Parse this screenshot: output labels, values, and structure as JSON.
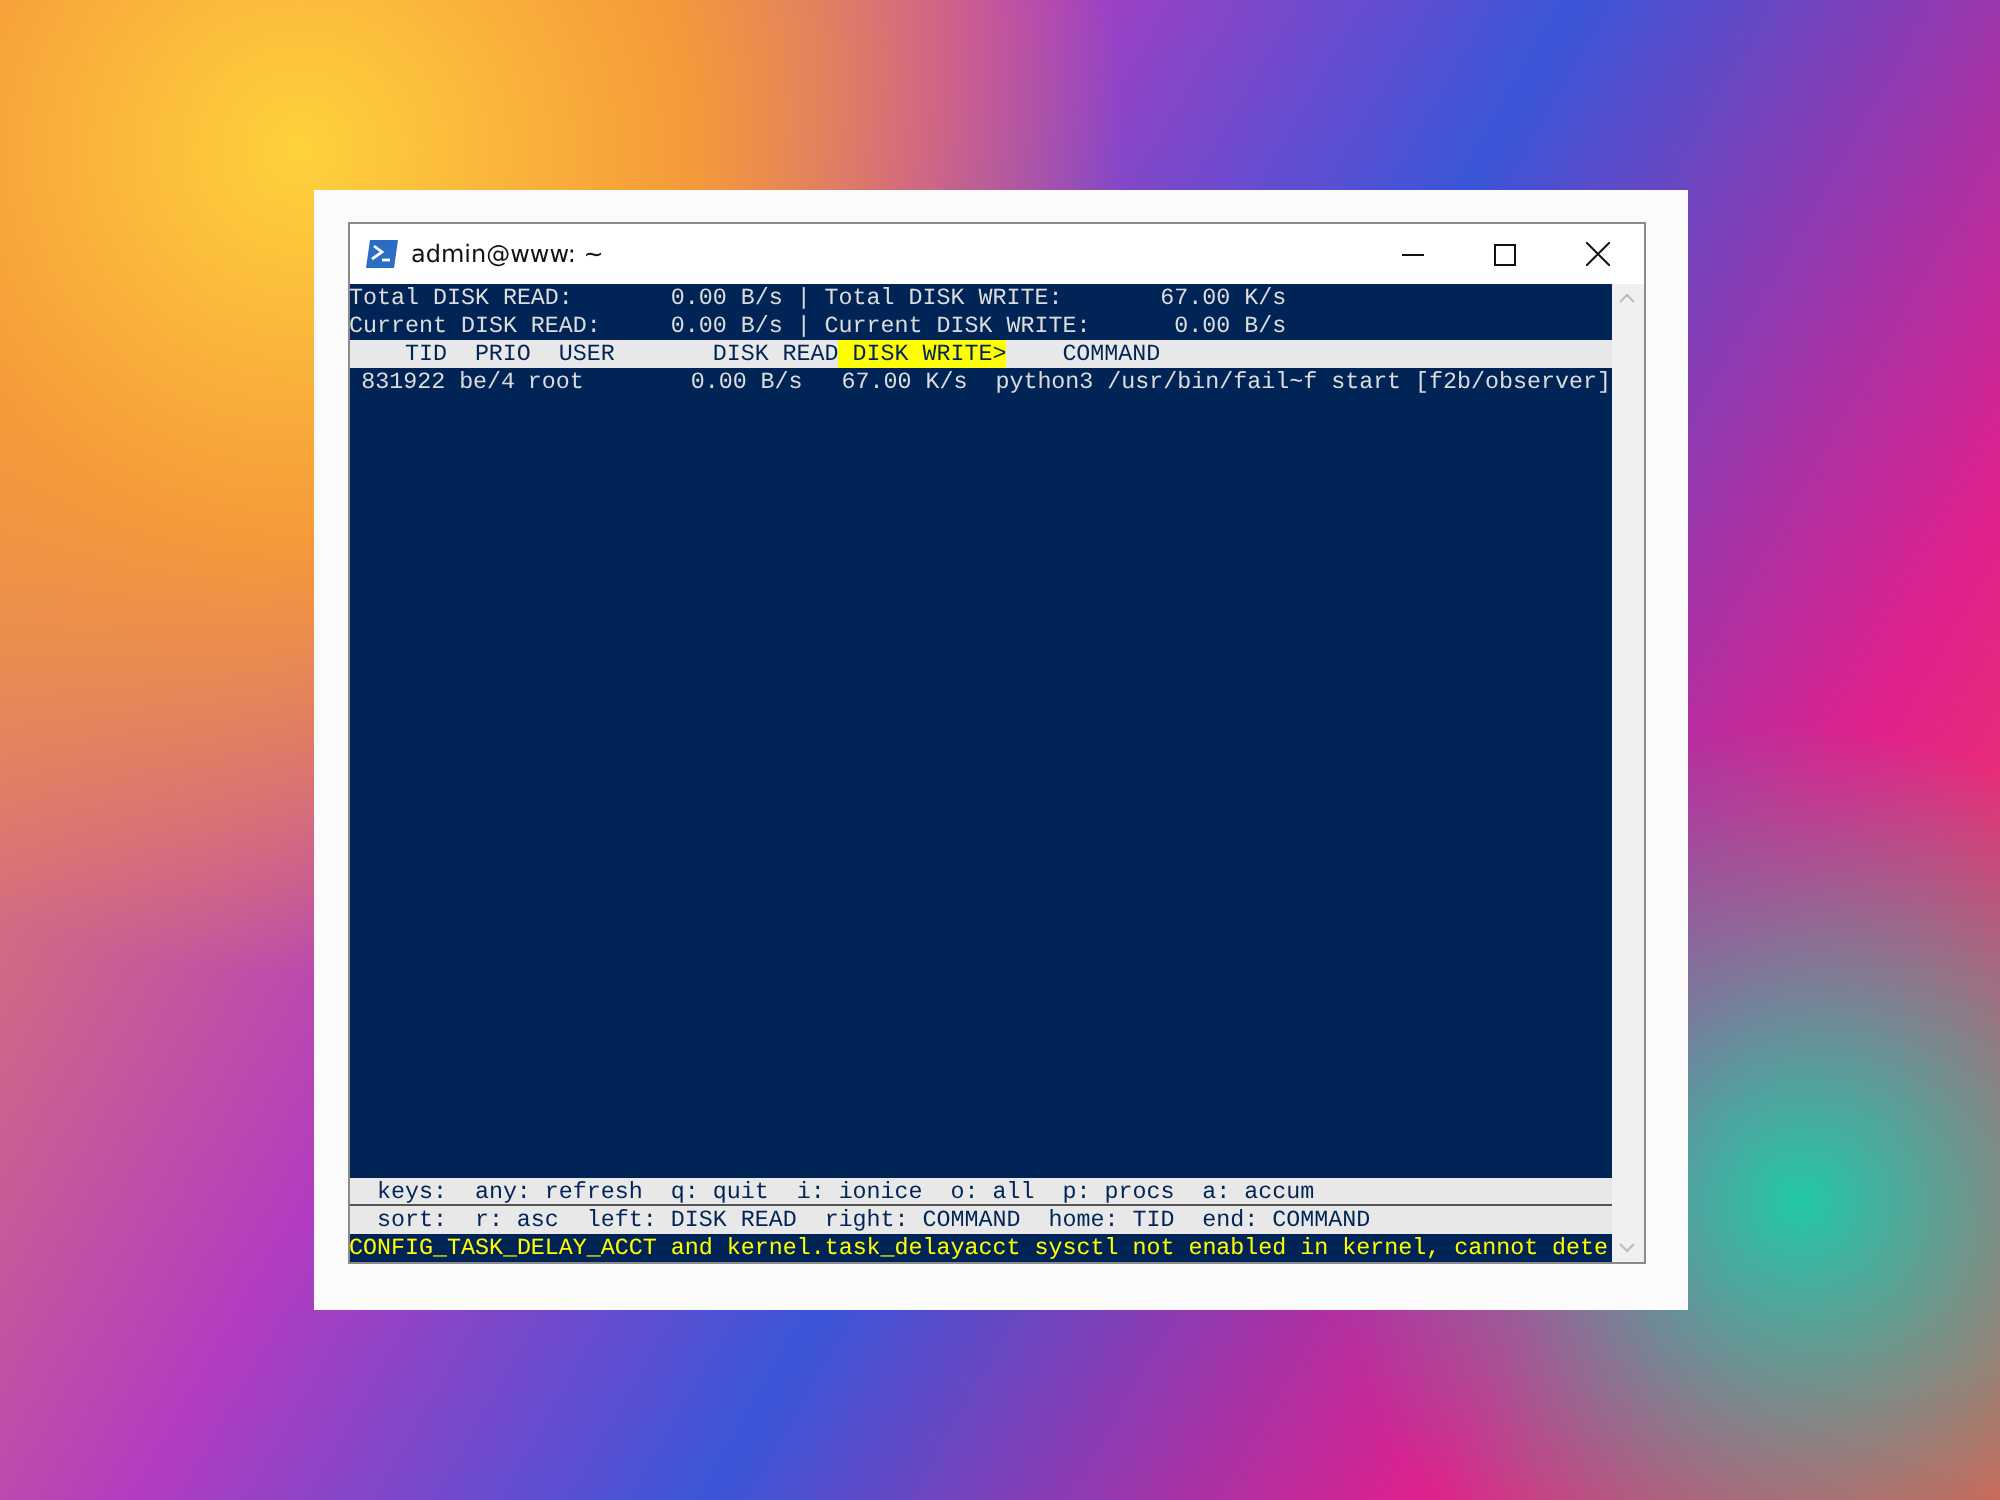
{
  "window": {
    "title": "admin@www: ~"
  },
  "summary": [
    {
      "left_label": "Total DISK READ:",
      "left_value": "0.00 B/s",
      "divider": "|",
      "right_label": "Total DISK WRITE:",
      "right_value": "67.00 K/s"
    },
    {
      "left_label": "Current DISK READ:",
      "left_value": "0.00 B/s",
      "divider": "|",
      "right_label": "Current DISK WRITE:",
      "right_value": "0.00 B/s"
    }
  ],
  "columns": [
    {
      "label": "TID",
      "selected": false
    },
    {
      "label": "PRIO",
      "selected": false
    },
    {
      "label": "USER",
      "selected": false
    },
    {
      "label": "DISK READ",
      "selected": false
    },
    {
      "label": "DISK WRITE>",
      "selected": true
    },
    {
      "label": "COMMAND",
      "selected": false
    }
  ],
  "rows": [
    {
      "cells": [
        "831922",
        "be/4",
        "root",
        "0.00 B/s",
        "67.00 K/s",
        "python3 /usr/bin/fail~f start [f2b/observer]"
      ]
    }
  ],
  "keys_line": "keys:  any: refresh  q: quit  i: ionice  o: all  p: procs  a: accum",
  "sort_line": "sort:  r: asc  left: DISK READ  right: COMMAND  home: TID  end: COMMAND",
  "warning": "CONFIG_TASK_DELAY_ACCT and kernel.task_delayacct sysctl not enabled in kernel, cannot dete"
}
